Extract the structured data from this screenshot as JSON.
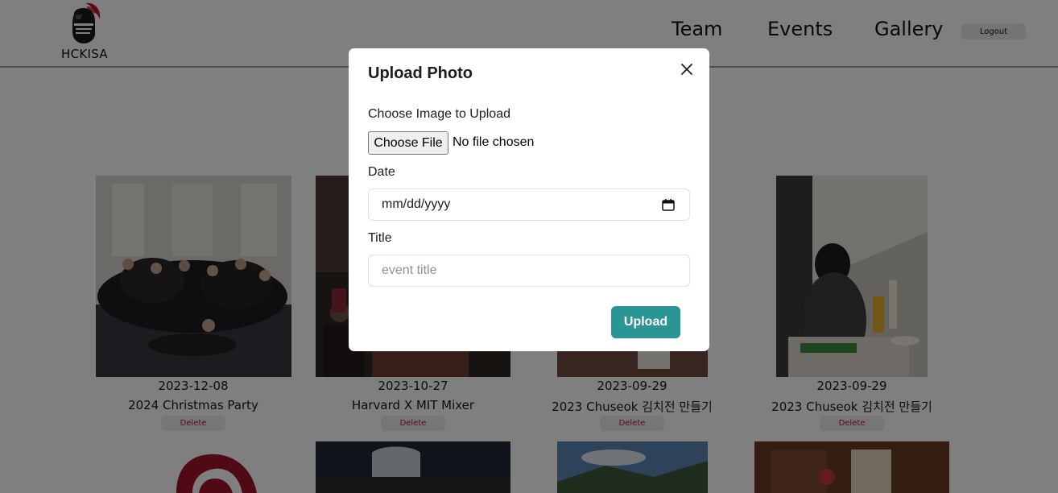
{
  "header": {
    "logo_text": "HCKISA",
    "nav": [
      {
        "label": "Team"
      },
      {
        "label": "Events"
      },
      {
        "label": "Gallery"
      }
    ],
    "logout_label": "Logout"
  },
  "gallery": {
    "delete_label": "Delete",
    "cards": [
      {
        "date": "2023-12-08",
        "title": "2024 Christmas Party"
      },
      {
        "date": "2023-10-27",
        "title": "Harvard X MIT Mixer"
      },
      {
        "date": "2023-09-29",
        "title": "2023 Chuseok 김치전 만들기"
      },
      {
        "date": "2023-09-29",
        "title": "2023 Chuseok 김치전 만들기"
      }
    ]
  },
  "modal": {
    "title": "Upload Photo",
    "image_label": "Choose Image to Upload",
    "file_button_label": "Choose File",
    "file_status": "No file chosen",
    "date_label": "Date",
    "date_value": "mm/dd/yyyy",
    "title_label": "Title",
    "title_placeholder": "event title",
    "upload_label": "Upload"
  },
  "colors": {
    "upload_button": "#2a9595",
    "delete_text": "#c0182b",
    "brand_red": "#a0142b",
    "overlay": "rgba(0,0,0,0.5)"
  },
  "icons": {
    "close": "close-icon",
    "calendar": "calendar-icon",
    "logo": "knight-helmet-icon"
  }
}
